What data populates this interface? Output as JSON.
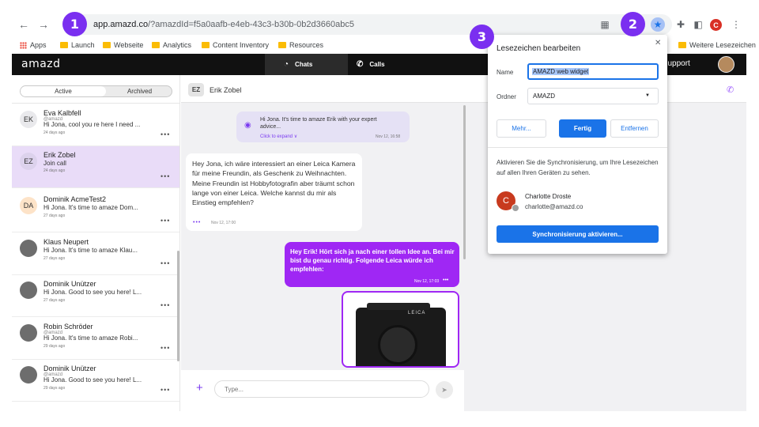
{
  "browser": {
    "url_host": "app.amazd.co",
    "url_path": "/?amazdId=f5a0aafb-e4eb-43c3-b30b-0b2d3660abc5",
    "profile_letter": "C",
    "bookmarks": [
      {
        "label": "Apps"
      },
      {
        "label": "Launch"
      },
      {
        "label": "Webseite"
      },
      {
        "label": "Analytics"
      },
      {
        "label": "Content Inventory"
      },
      {
        "label": "Resources"
      }
    ],
    "other_bookmarks": "Weitere Lesezeichen"
  },
  "app": {
    "logo": "amazd",
    "tabs": {
      "chats": "Chats",
      "calls": "Calls"
    },
    "support": "AZD Support"
  },
  "sidebar": {
    "tab_active": "Active",
    "tab_archived": "Archived",
    "items": [
      {
        "initials": "EK",
        "name": "Eva Kalbfell",
        "sub": "@amazd",
        "preview": "Hi Jona, cool you re here I need ...",
        "time": "24 days ago",
        "color": "#e9e9ec"
      },
      {
        "initials": "EZ",
        "name": "Erik Zobel",
        "sub": "",
        "preview": "Join call",
        "time": "24 days ago",
        "color": "#dcd2ec"
      },
      {
        "initials": "DA",
        "name": "Dominik AcmeTest2",
        "sub": "",
        "preview": "Hi Jona. It's time to amaze Dom...",
        "time": "27 days ago",
        "color": "#fde3c8"
      },
      {
        "initials": "",
        "name": "Klaus Neupert",
        "sub": "",
        "preview": "Hi Jona. It's time to amaze Klau...",
        "time": "27 days ago",
        "color": ""
      },
      {
        "initials": "",
        "name": "Dominik Unützer",
        "sub": "",
        "preview": "Hi Jona. Good to see you here! L...",
        "time": "27 days ago",
        "color": ""
      },
      {
        "initials": "",
        "name": "Robin Schröder",
        "sub": "@amazd",
        "preview": "Hi Jona. It's time to amaze Robi...",
        "time": "29 days ago",
        "color": ""
      },
      {
        "initials": "",
        "name": "Dominik Unützer",
        "sub": "@amazd",
        "preview": "Hi Jona. Good to see you here! L...",
        "time": "29 days ago",
        "color": ""
      }
    ]
  },
  "chat": {
    "header_initials": "EZ",
    "header_name": "Erik Zobel",
    "system_message": "Hi Jona. It's time to amaze Erik with your expert advice...",
    "system_link": "Click to expand ∨",
    "system_time": "Nov 12, 16:58",
    "incoming_text": "Hey Jona, ich wäre interessiert an einer Leica Kamera für meine Freundin, als Geschenk zu Weihnachten. Meine Freundin ist Hobbyfotografin aber träumt schon lange von einer Leica. Welche kannst du mir als Einstieg empfehlen?",
    "incoming_time": "Nov 12, 17:00",
    "outgoing_text": "Hey Erik! Hört sich ja nach einer tollen Idee an. Bei mir bist du genau richtig. Folgende Leica würde ich empfehlen:",
    "outgoing_time": "Nov 12, 17:03",
    "camera_brand": "LEICA",
    "composer_placeholder": "Type..."
  },
  "popup": {
    "title": "Lesezeichen bearbeiten",
    "name_label": "Name",
    "name_value": "AMAZD web widget",
    "folder_label": "Ordner",
    "folder_value": "AMAZD",
    "btn_more": "Mehr...",
    "btn_done": "Fertig",
    "btn_remove": "Entfernen",
    "sync_text": "Aktivieren Sie die Synchronisierung, um Ihre Lesezeichen auf allen Ihren Geräten zu sehen.",
    "account_initial": "C",
    "account_name": "Charlotte Droste",
    "account_email": "charlotte@amazd.co",
    "sync_button": "Synchronisierung aktivieren..."
  },
  "callouts": [
    "1",
    "2",
    "3"
  ],
  "colors": {
    "accent": "#9f27f4",
    "chrome_blue": "#1a73e8",
    "callout": "#7a2ff0"
  }
}
